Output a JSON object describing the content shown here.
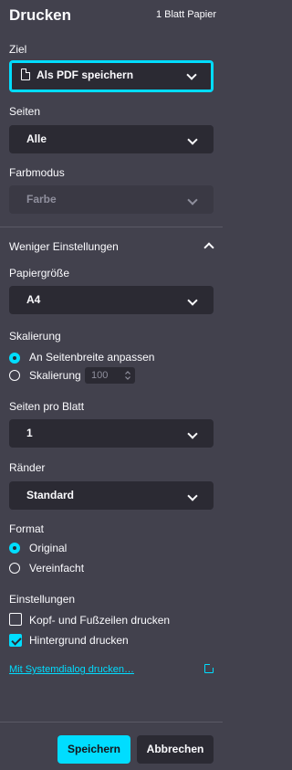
{
  "header": {
    "title": "Drucken",
    "sheet_count": "1 Blatt Papier"
  },
  "destination": {
    "label": "Ziel",
    "value": "Als PDF speichern"
  },
  "pages": {
    "label": "Seiten",
    "value": "Alle"
  },
  "color_mode": {
    "label": "Farbmodus",
    "value": "Farbe"
  },
  "more_settings": {
    "label": "Weniger Einstellungen"
  },
  "paper_size": {
    "label": "Papiergröße",
    "value": "A4"
  },
  "scaling": {
    "label": "Skalierung",
    "options": [
      "An Seitenbreite anpassen",
      "Skalierung"
    ],
    "selected": 0,
    "value": "100"
  },
  "pages_per_sheet": {
    "label": "Seiten pro Blatt",
    "value": "1"
  },
  "margins": {
    "label": "Ränder",
    "value": "Standard"
  },
  "format": {
    "label": "Format",
    "options": [
      "Original",
      "Vereinfacht"
    ],
    "selected": 0
  },
  "settings": {
    "label": "Einstellungen",
    "headers_footers": {
      "label": "Kopf- und Fußzeilen drucken",
      "checked": false
    },
    "backgrounds": {
      "label": "Hintergrund drucken",
      "checked": true
    }
  },
  "system_dialog_link": "Mit Systemdialog drucken…",
  "buttons": {
    "save": "Speichern",
    "cancel": "Abbrechen"
  },
  "colors": {
    "accent": "#00ddff",
    "background": "#42414d",
    "field": "#2b2a33",
    "text": "#fbfbfe"
  }
}
